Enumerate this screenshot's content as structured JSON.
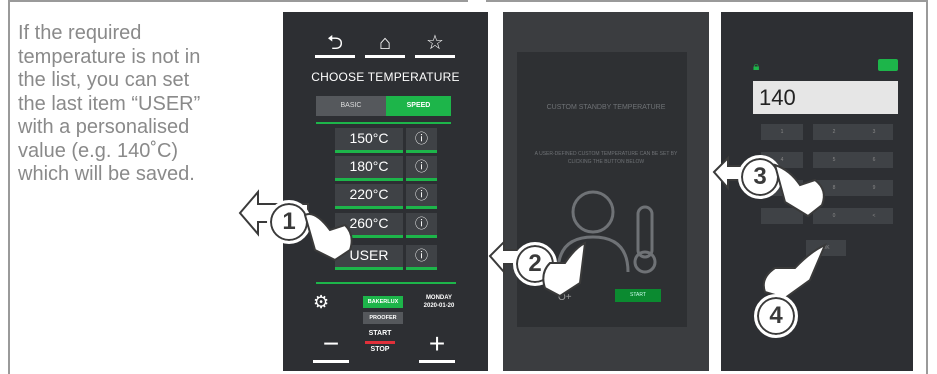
{
  "description": {
    "lines": [
      "If the required",
      "temperature is not in",
      "the list, you can set",
      "the last item “USER”",
      "with a personalised",
      "value (e.g. 140˚C)",
      "which will be saved."
    ]
  },
  "panel1": {
    "top_icons": [
      "back-icon",
      "home-icon",
      "star-icon"
    ],
    "top_glyphs": [
      "⮌",
      "⌂",
      "☆"
    ],
    "title": "CHOOSE TEMPERATURE",
    "tabs": [
      "BASIC",
      "SPEED"
    ],
    "temperatures": [
      "150°C",
      "180°C",
      "220°C",
      "260°C",
      "USER"
    ],
    "info_glyph": "ⓘ",
    "modes": [
      "BAKERLUX",
      "PROOFER"
    ],
    "day": "MONDAY",
    "date": "2020-01-20",
    "minus": "−",
    "plus": "+",
    "start": "START",
    "stop": "STOP"
  },
  "panel2": {
    "title": "CUSTOM STANDBY TEMPERATURE",
    "text": "A USER-DEFINED CUSTOM TEMPERATURE CAN BE SET BY CLICKING THE BUTTON BELOW",
    "start_label": "START",
    "key_glyph": "O+"
  },
  "panel3": {
    "display_value": "140",
    "keys": [
      "1",
      "2",
      "3",
      "4",
      "5",
      "6",
      "7",
      "8",
      "9",
      "",
      "0",
      "<"
    ],
    "ok_label": "OK"
  },
  "callouts": [
    "1",
    "2",
    "3",
    "4"
  ],
  "colors": {
    "accent": "#1db54a",
    "panel": "#2d2f33",
    "text_gray": "#8a8a8a",
    "stop_red": "#e0303a"
  }
}
